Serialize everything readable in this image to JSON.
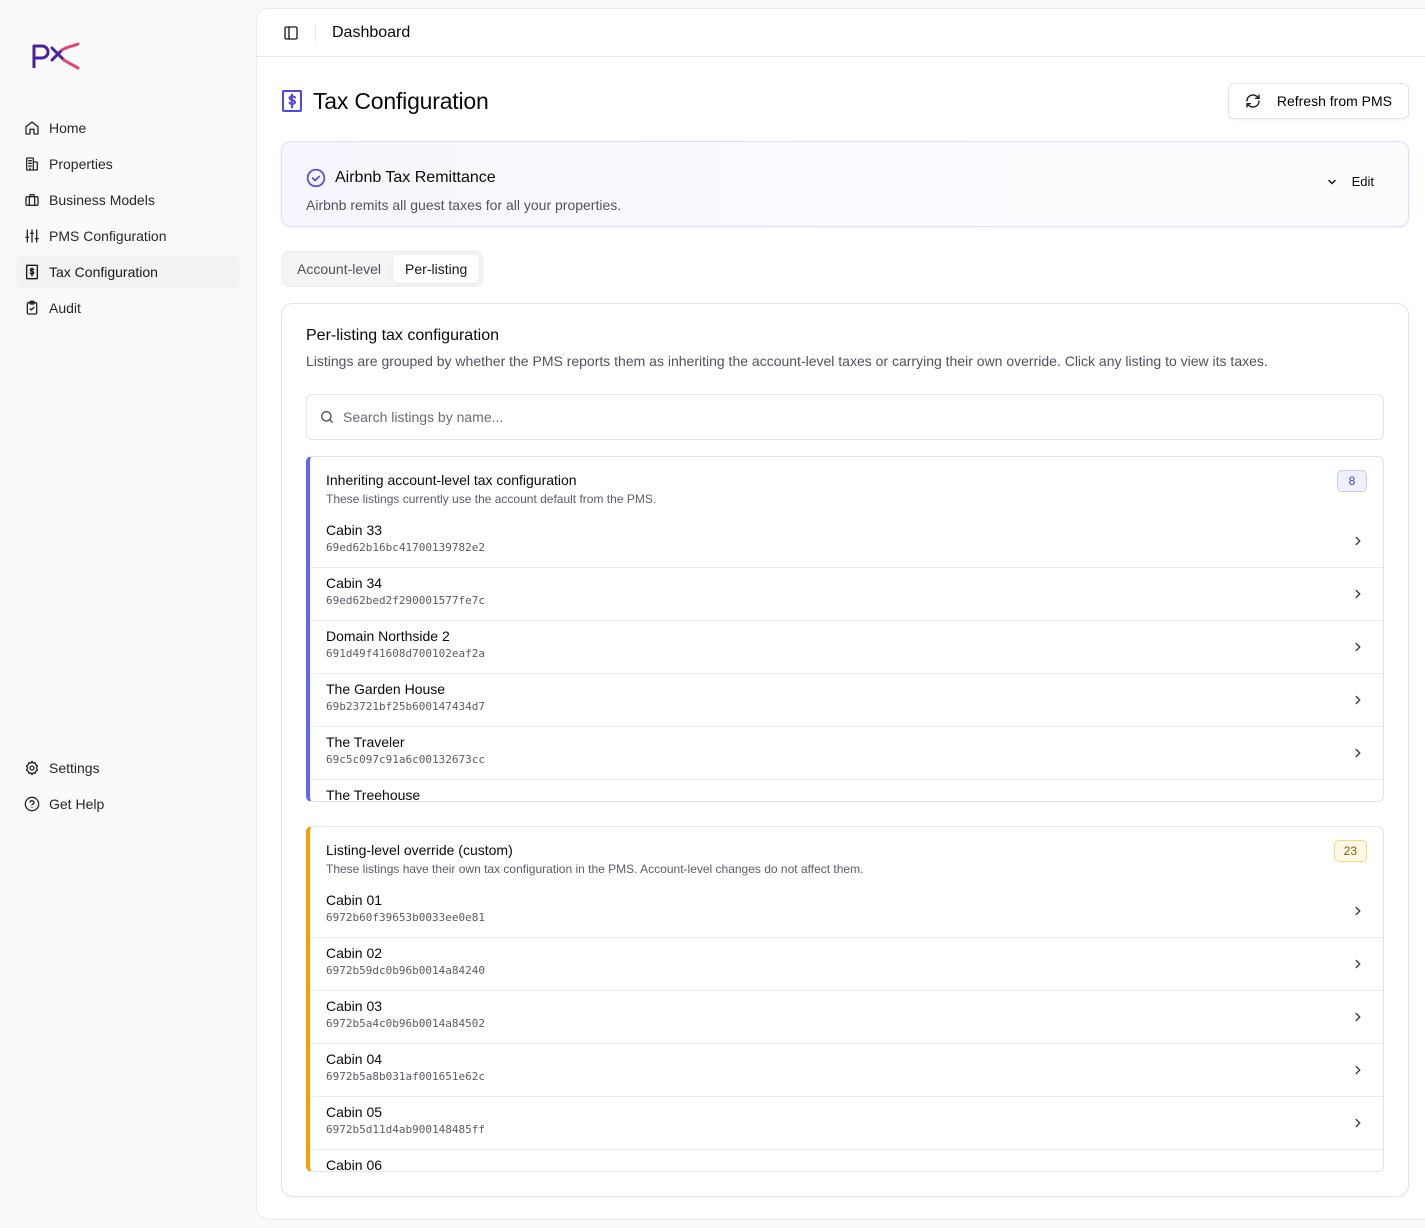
{
  "app": {
    "logo_alt": "PX"
  },
  "sidebar": {
    "items": [
      {
        "label": "Home",
        "icon": "home-icon"
      },
      {
        "label": "Properties",
        "icon": "building-icon"
      },
      {
        "label": "Business Models",
        "icon": "briefcase-icon"
      },
      {
        "label": "PMS Configuration",
        "icon": "sliders-icon"
      },
      {
        "label": "Tax Configuration",
        "icon": "receipt-icon",
        "active": true
      },
      {
        "label": "Audit",
        "icon": "clipboard-check-icon"
      }
    ],
    "bottom_items": [
      {
        "label": "Settings",
        "icon": "gear-icon"
      },
      {
        "label": "Get Help",
        "icon": "help-circle-icon"
      }
    ]
  },
  "topbar": {
    "breadcrumb": "Dashboard"
  },
  "page": {
    "title": "Tax Configuration",
    "refresh_label": "Refresh from PMS"
  },
  "remittance": {
    "title": "Airbnb Tax Remittance",
    "description": "Airbnb remits all guest taxes for all your properties.",
    "edit_label": "Edit"
  },
  "tabs": [
    {
      "label": "Account-level",
      "active": false
    },
    {
      "label": "Per-listing",
      "active": true
    }
  ],
  "config": {
    "title": "Per-listing tax configuration",
    "description": "Listings are grouped by whether the PMS reports them as inheriting the account-level taxes or carrying their own override. Click any listing to view its taxes.",
    "search_placeholder": "Search listings by name..."
  },
  "groups": {
    "inherit": {
      "title": "Inheriting account-level tax configuration",
      "subtitle": "These listings currently use the account default from the PMS.",
      "count": "8",
      "accent": "#6366f1",
      "listings": [
        {
          "name": "Cabin 33",
          "id": "69ed62b16bc41700139782e2"
        },
        {
          "name": "Cabin 34",
          "id": "69ed62bed2f290001577fe7c"
        },
        {
          "name": "Domain Northside 2",
          "id": "691d49f41608d700102eaf2a"
        },
        {
          "name": "The Garden House",
          "id": "69b23721bf25b600147434d7"
        },
        {
          "name": "The Traveler",
          "id": "69c5c097c91a6c00132673cc"
        },
        {
          "name": "The Treehouse",
          "id": ""
        }
      ]
    },
    "override": {
      "title": "Listing-level override (custom)",
      "subtitle": "These listings have their own tax configuration in the PMS. Account-level changes do not affect them.",
      "count": "23",
      "accent": "#f59e0b",
      "listings": [
        {
          "name": "Cabin 01",
          "id": "6972b60f39653b0033ee0e81"
        },
        {
          "name": "Cabin 02",
          "id": "6972b59dc0b96b0014a84240"
        },
        {
          "name": "Cabin 03",
          "id": "6972b5a4c0b96b0014a84502"
        },
        {
          "name": "Cabin 04",
          "id": "6972b5a8b031af001651e62c"
        },
        {
          "name": "Cabin 05",
          "id": "6972b5d11d4ab900148485ff"
        },
        {
          "name": "Cabin 06",
          "id": ""
        }
      ]
    }
  },
  "colors": {
    "brand_purple": "#4b1f9e",
    "brand_pink": "#e0457b",
    "accent_indigo": "#6366f1",
    "accent_amber": "#f59e0b"
  }
}
